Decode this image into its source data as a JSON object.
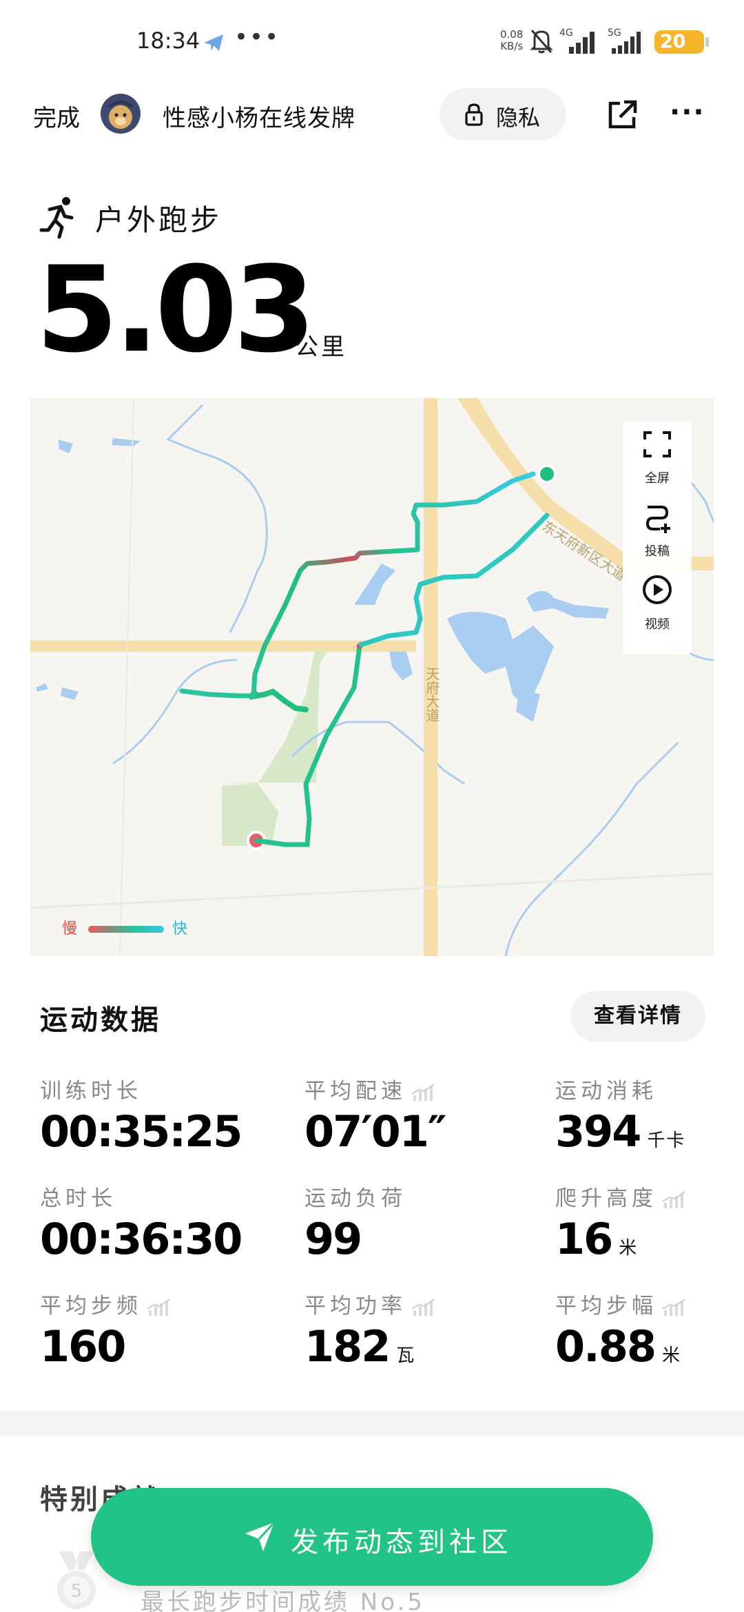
{
  "status_bar": {
    "time": "18:34",
    "net_speed_value": "0.08",
    "net_speed_unit": "KB/s",
    "signal_1": "4G",
    "signal_2": "5G",
    "battery": "20",
    "icons": [
      "telegram-icon",
      "more-dots-icon",
      "bell-off-icon",
      "signal-icon",
      "battery-icon"
    ]
  },
  "header": {
    "done_label": "完成",
    "username": "性感小杨在线发牌",
    "privacy_label": "隐私",
    "icons": [
      "lock-icon",
      "share-icon",
      "more-icon"
    ]
  },
  "summary": {
    "sport_type": "户外跑步",
    "distance": "5.03",
    "distance_unit": "公里"
  },
  "map": {
    "road_labels": [
      "天府大道",
      "东天府新区大道"
    ],
    "tools": [
      {
        "label": "全屏",
        "icon": "fullscreen-icon"
      },
      {
        "label": "投稿",
        "icon": "route-submit-icon"
      },
      {
        "label": "视频",
        "icon": "play-icon"
      }
    ],
    "legend_slow": "慢",
    "legend_fast": "快",
    "colors": {
      "route_fast": "#3cc9e6",
      "route_mid": "#25c29a",
      "route_slow": "#e55a5a",
      "start": "#1fbf7f",
      "end": "#ef5a6a"
    }
  },
  "stats": {
    "title": "运动数据",
    "detail_button": "查看详情",
    "items": [
      {
        "label": "训练时长",
        "value": "00:35:25",
        "unit": ""
      },
      {
        "label": "平均配速",
        "value": "07′01″",
        "unit": ""
      },
      {
        "label": "运动消耗",
        "value": "394",
        "unit": "千卡"
      },
      {
        "label": "总时长",
        "value": "00:36:30",
        "unit": ""
      },
      {
        "label": "运动负荷",
        "value": "99",
        "unit": ""
      },
      {
        "label": "爬升高度",
        "value": "16",
        "unit": "米"
      },
      {
        "label": "平均步频",
        "value": "160",
        "unit": ""
      },
      {
        "label": "平均功率",
        "value": "182",
        "unit": "瓦"
      },
      {
        "label": "平均步幅",
        "value": "0.88",
        "unit": "米"
      }
    ]
  },
  "special": {
    "title": "特别成就",
    "record": "最长跑步时间成绩 No.5",
    "medal_rank": "5"
  },
  "publish_button": "发布动态到社区",
  "accent_color": "#22c386"
}
